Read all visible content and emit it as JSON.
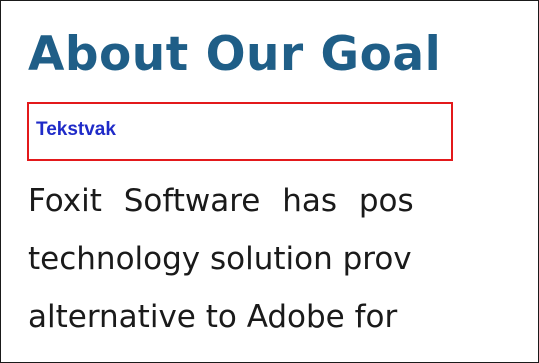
{
  "document": {
    "heading": "About Our Goal",
    "text_box": {
      "label": "Tekstvak"
    },
    "paragraph_lines": [
      "Foxit Software has pos",
      "technology solution prov",
      "alternative to Adobe for"
    ]
  },
  "colors": {
    "heading": "#1f5e87",
    "text_box_border": "#e3191b",
    "text_box_label": "#1f2bc8",
    "body_text": "#1a1a1a"
  }
}
